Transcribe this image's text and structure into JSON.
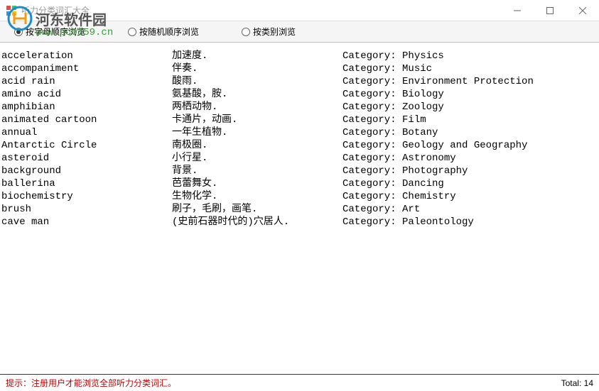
{
  "window": {
    "title": "听力分类词汇大全"
  },
  "watermark": {
    "text": "河东软件园",
    "url": "www.pc0359.cn"
  },
  "toolbar": {
    "options": [
      {
        "label": "按字母顺序浏览",
        "selected": true
      },
      {
        "label": "按随机顺序浏览",
        "selected": false
      },
      {
        "label": "按类别浏览",
        "selected": false
      }
    ]
  },
  "vocab": [
    {
      "word": "acceleration",
      "def": "加速度.",
      "cat": "Category: Physics"
    },
    {
      "word": "accompaniment",
      "def": "伴奏.",
      "cat": "Category: Music"
    },
    {
      "word": "acid rain",
      "def": "酸雨.",
      "cat": "Category: Environment Protection"
    },
    {
      "word": "amino acid",
      "def": "氨基酸，胺.",
      "cat": "Category: Biology"
    },
    {
      "word": "amphibian",
      "def": "两栖动物.",
      "cat": "Category: Zoology"
    },
    {
      "word": "animated cartoon",
      "def": "卡通片，动画.",
      "cat": "Category: Film"
    },
    {
      "word": "annual",
      "def": "一年生植物.",
      "cat": "Category: Botany"
    },
    {
      "word": "Antarctic Circle",
      "def": "南极圈.",
      "cat": "Category: Geology and Geography"
    },
    {
      "word": "asteroid",
      "def": "小行星.",
      "cat": "Category: Astronomy"
    },
    {
      "word": "background",
      "def": "背景.",
      "cat": "Category: Photography"
    },
    {
      "word": "ballerina",
      "def": "芭蕾舞女.",
      "cat": "Category: Dancing"
    },
    {
      "word": "biochemistry",
      "def": "生物化学.",
      "cat": "Category: Chemistry"
    },
    {
      "word": "brush",
      "def": "刷子，毛刷，画笔.",
      "cat": "Category: Art"
    },
    {
      "word": "cave man",
      "def": "(史前石器时代的)穴居人.",
      "cat": "Category: Paleontology"
    }
  ],
  "status": {
    "message": "提示：注册用户才能浏览全部听力分类词汇。",
    "total_label": "Total:",
    "total_value": "14"
  }
}
